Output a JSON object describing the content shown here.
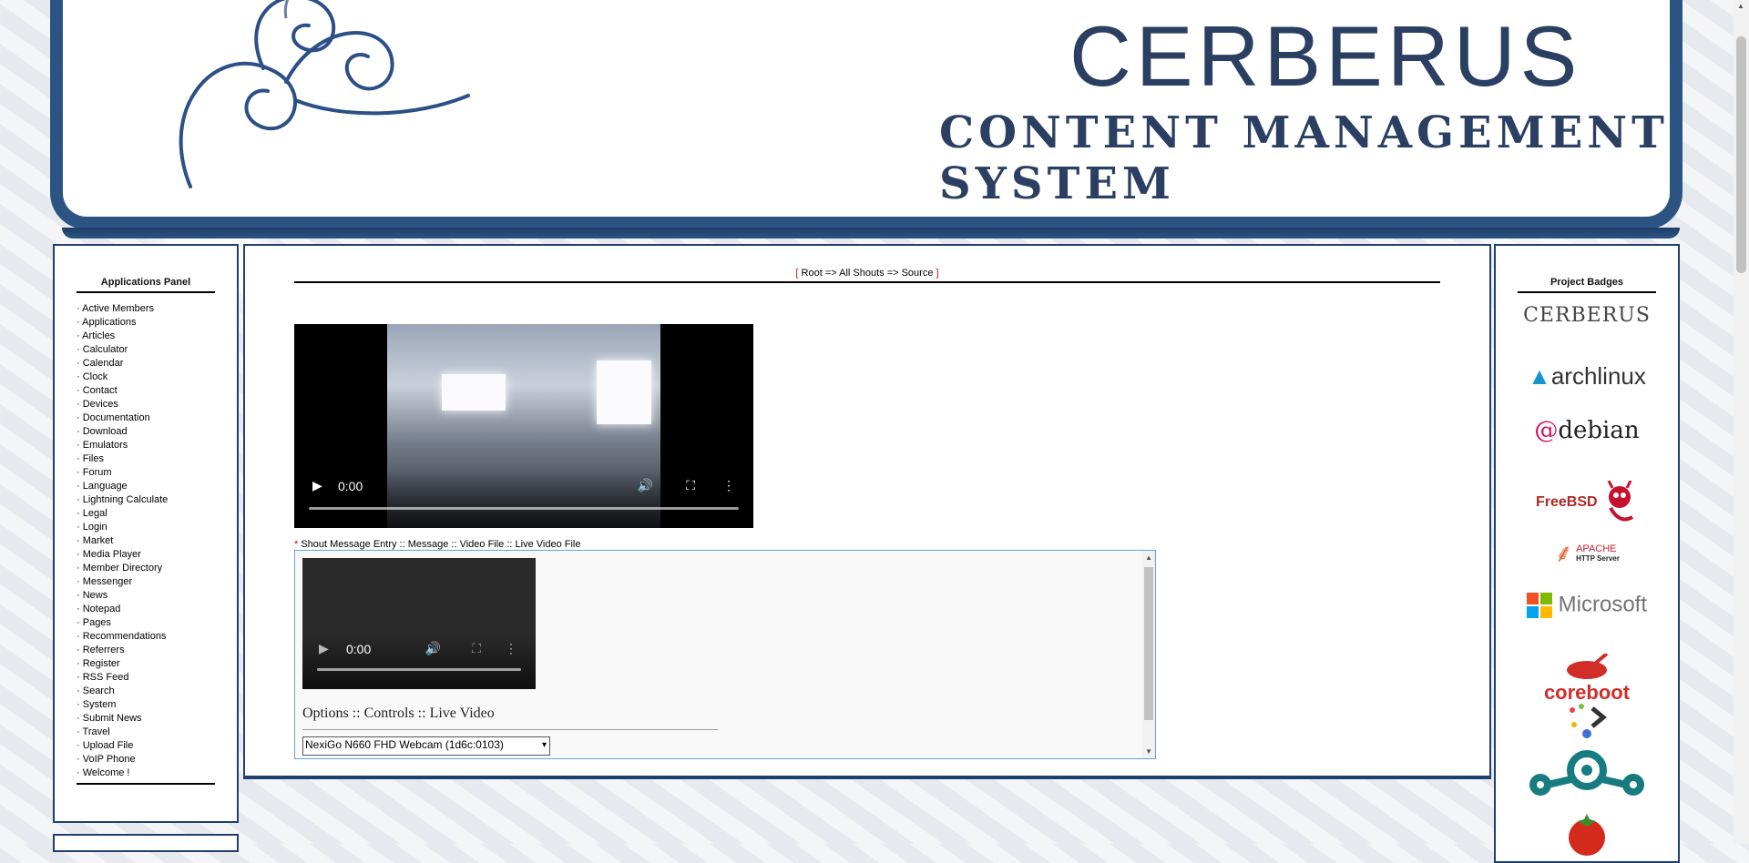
{
  "header": {
    "title": "CERBERUS",
    "subtitle": "CONTENT MANAGEMENT SYSTEM"
  },
  "apps_panel": {
    "title": "Applications Panel",
    "items": [
      "Active Members",
      "Applications",
      "Articles",
      "Calculator",
      "Calendar",
      "Clock",
      "Contact",
      "Devices",
      "Documentation",
      "Download",
      "Emulators",
      "Files",
      "Forum",
      "Language",
      "Lightning Calculate",
      "Legal",
      "Login",
      "Market",
      "Media Player",
      "Member Directory",
      "Messenger",
      "News",
      "Notepad",
      "Pages",
      "Recommendations",
      "Referrers",
      "Register",
      "RSS Feed",
      "Search",
      "System",
      "Submit News",
      "Travel",
      "Upload File",
      "VoIP Phone",
      "Welcome !"
    ]
  },
  "main": {
    "breadcrumb": {
      "open": "[",
      "text": " Root => All Shouts => Source ",
      "close": "]"
    },
    "video_main": {
      "time": "0:00"
    },
    "entry_label": {
      "star": "*",
      "text": " Shout Message Entry :: Message :: Video File :: Live Video File"
    },
    "video_preview": {
      "time": "0:00"
    },
    "options_title": "Options :: Controls :: Live Video",
    "camera_select": "NexiGo N660 FHD Webcam (1d6c:0103)"
  },
  "badges_panel": {
    "title": "Project Badges",
    "cerberus": "CERBERUS",
    "arch": "archlinux",
    "debian": "debian",
    "freebsd": "FreeBSD",
    "apache_top": "APACHE",
    "apache_bottom": "HTTP Server",
    "microsoft": "Microsoft",
    "coreboot": "coreboot"
  },
  "colors": {
    "frame": "#2c5483",
    "brand_text": "#2a3f62",
    "bracket_red": "#b5121b"
  }
}
